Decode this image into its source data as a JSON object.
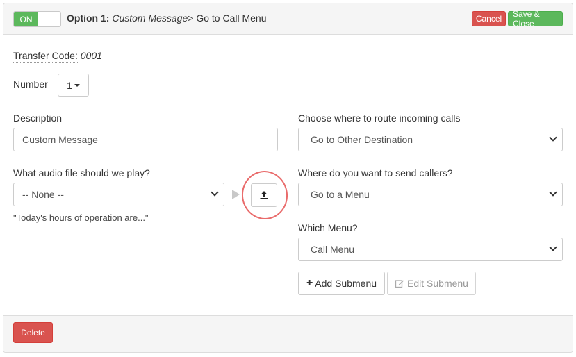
{
  "header": {
    "toggle_label": "ON",
    "option_prefix": "Option 1:",
    "option_name": "Custom Message",
    "option_separator": ">",
    "option_destination": "Go to Call Menu",
    "cancel_label": "Cancel",
    "save_label": "Save & Close"
  },
  "transfer": {
    "label": "Transfer Code:",
    "value": "0001"
  },
  "number": {
    "label": "Number",
    "value": "1"
  },
  "description": {
    "label": "Description",
    "value": "Custom Message"
  },
  "audio": {
    "label": "What audio file should we play?",
    "selected": "-- None --",
    "transcript": "\"Today's hours of operation are...\"",
    "play_icon": "play-icon",
    "upload_icon": "upload-icon"
  },
  "route": {
    "label": "Choose where to route incoming calls",
    "selected": "Go to Other Destination"
  },
  "send": {
    "label": "Where do you want to send callers?",
    "selected": "Go to a Menu"
  },
  "menu": {
    "label": "Which Menu?",
    "selected": "Call Menu"
  },
  "submenu": {
    "add_label": "Add Submenu",
    "edit_label": "Edit Submenu"
  },
  "footer": {
    "delete_label": "Delete"
  },
  "colors": {
    "success": "#5cb85c",
    "danger": "#d9534f",
    "annotation": "#e23a3a"
  }
}
